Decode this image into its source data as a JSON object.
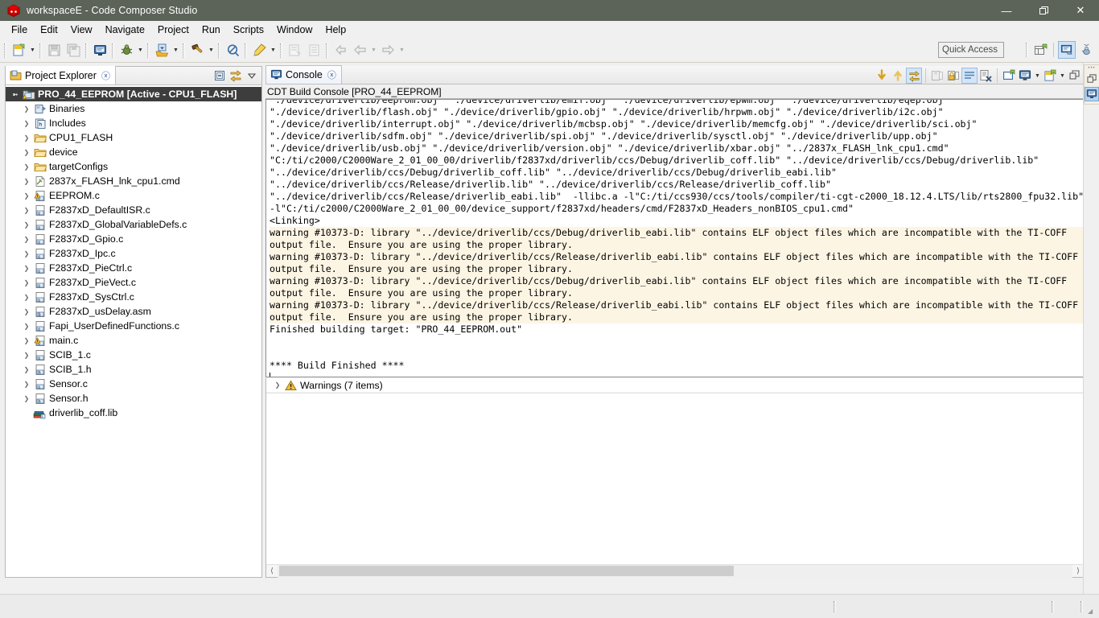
{
  "window": {
    "title": "workspaceE - Code Composer Studio",
    "app_icon": "ccs-cube-icon",
    "controls": [
      {
        "name": "minimize-button",
        "glyph": "—"
      },
      {
        "name": "restore-button",
        "glyph": "❐"
      },
      {
        "name": "close-button",
        "glyph": "✕"
      }
    ]
  },
  "menubar": {
    "items": [
      "File",
      "Edit",
      "View",
      "Navigate",
      "Project",
      "Run",
      "Scripts",
      "Window",
      "Help"
    ]
  },
  "toolbar": {
    "quick_access_placeholder": "Quick Access",
    "buttons": [
      {
        "name": "new-button",
        "icon": "new-file-icon"
      },
      {
        "name": "save-button",
        "icon": "save-icon"
      },
      {
        "name": "save-all-button",
        "icon": "save-all-icon"
      },
      {
        "name": "open-console-button",
        "icon": "console-monitor-icon"
      },
      {
        "name": "debug-button",
        "icon": "debug-bug-icon"
      },
      {
        "name": "resume-button",
        "icon": "import-icon"
      },
      {
        "name": "build-button",
        "icon": "hammer-icon"
      },
      {
        "name": "no-entry-button",
        "icon": "prohibited-icon"
      },
      {
        "name": "highlight-button",
        "icon": "marker-pen-icon"
      },
      {
        "name": "new-target-button",
        "icon": "target-config-icon"
      },
      {
        "name": "grid-button",
        "icon": "table-icon"
      },
      {
        "name": "back-nav-button",
        "icon": "back-arrow-icon"
      },
      {
        "name": "prev-button",
        "icon": "left-arrow-icon"
      },
      {
        "name": "next-button",
        "icon": "right-arrow-icon"
      }
    ],
    "perspective": [
      {
        "name": "open-perspective-button",
        "icon": "open-perspective-icon"
      },
      {
        "name": "perspective-ccs-edit",
        "icon": "ccs-edit-perspective-icon",
        "active": true
      },
      {
        "name": "perspective-ccs-debug",
        "icon": "ccs-debug-perspective-icon",
        "active": false
      }
    ]
  },
  "project_explorer": {
    "tab_label": "Project Explorer",
    "tab_icon": "project-explorer-icon",
    "close_icon": "close-icon",
    "toolbar": [
      {
        "name": "collapse-all-button",
        "icon": "collapse-all-icon"
      },
      {
        "name": "link-with-editor-button",
        "icon": "link-editor-icon"
      },
      {
        "name": "view-menu-button",
        "icon": "view-menu-chevron-icon"
      }
    ],
    "tree": [
      {
        "label": "PRO_44_EEPROM [Active - CPU1_FLASH]",
        "icon": "ccs-project-icon",
        "indent": 0,
        "twisty": "down",
        "selected": true
      },
      {
        "label": "Binaries",
        "icon": "binaries-icon",
        "indent": 1,
        "twisty": "right",
        "selected": false
      },
      {
        "label": "Includes",
        "icon": "includes-icon",
        "indent": 1,
        "twisty": "right",
        "selected": false
      },
      {
        "label": "CPU1_FLASH",
        "icon": "folder-icon",
        "indent": 1,
        "twisty": "right",
        "selected": false
      },
      {
        "label": "device",
        "icon": "folder-icon",
        "indent": 1,
        "twisty": "right",
        "selected": false
      },
      {
        "label": "targetConfigs",
        "icon": "folder-icon",
        "indent": 1,
        "twisty": "right",
        "selected": false
      },
      {
        "label": "2837x_FLASH_lnk_cpu1.cmd",
        "icon": "cmd-file-icon",
        "indent": 1,
        "twisty": "right",
        "selected": false
      },
      {
        "label": "EEPROM.c",
        "icon": "c-file-warning-icon",
        "indent": 1,
        "twisty": "right",
        "selected": false
      },
      {
        "label": "F2837xD_DefaultISR.c",
        "icon": "c-file-icon",
        "indent": 1,
        "twisty": "right",
        "selected": false
      },
      {
        "label": "F2837xD_GlobalVariableDefs.c",
        "icon": "c-file-icon",
        "indent": 1,
        "twisty": "right",
        "selected": false
      },
      {
        "label": "F2837xD_Gpio.c",
        "icon": "c-file-icon",
        "indent": 1,
        "twisty": "right",
        "selected": false
      },
      {
        "label": "F2837xD_Ipc.c",
        "icon": "c-file-icon",
        "indent": 1,
        "twisty": "right",
        "selected": false
      },
      {
        "label": "F2837xD_PieCtrl.c",
        "icon": "c-file-icon",
        "indent": 1,
        "twisty": "right",
        "selected": false
      },
      {
        "label": "F2837xD_PieVect.c",
        "icon": "c-file-icon",
        "indent": 1,
        "twisty": "right",
        "selected": false
      },
      {
        "label": "F2837xD_SysCtrl.c",
        "icon": "c-file-icon",
        "indent": 1,
        "twisty": "right",
        "selected": false
      },
      {
        "label": "F2837xD_usDelay.asm",
        "icon": "asm-file-icon",
        "indent": 1,
        "twisty": "right",
        "selected": false
      },
      {
        "label": "Fapi_UserDefinedFunctions.c",
        "icon": "c-file-icon",
        "indent": 1,
        "twisty": "right",
        "selected": false
      },
      {
        "label": "main.c",
        "icon": "c-file-warning-icon",
        "indent": 1,
        "twisty": "right",
        "selected": false
      },
      {
        "label": "SCIB_1.c",
        "icon": "c-file-icon",
        "indent": 1,
        "twisty": "right",
        "selected": false
      },
      {
        "label": "SCIB_1.h",
        "icon": "h-file-icon",
        "indent": 1,
        "twisty": "right",
        "selected": false
      },
      {
        "label": "Sensor.c",
        "icon": "c-file-icon",
        "indent": 1,
        "twisty": "right",
        "selected": false
      },
      {
        "label": "Sensor.h",
        "icon": "h-file-icon",
        "indent": 1,
        "twisty": "right",
        "selected": false
      },
      {
        "label": "driverlib_coff.lib",
        "icon": "library-icon",
        "indent": 1,
        "twisty": "none",
        "selected": false
      }
    ]
  },
  "console": {
    "tab_label": "Console",
    "tab_icon": "console-monitor-icon",
    "close_icon": "close-icon",
    "subtitle": "CDT Build Console [PRO_44_EEPROM]",
    "toolbar": [
      {
        "name": "scroll-lock-down-button",
        "icon": "down-arrow-icon"
      },
      {
        "name": "scroll-up-button",
        "icon": "up-arrow-icon"
      },
      {
        "name": "pin-console-button",
        "icon": "link-editor-icon",
        "active": true
      },
      {
        "name": "save-console-button",
        "icon": "save-console-icon"
      },
      {
        "name": "lock-console-button",
        "icon": "lock-icon"
      },
      {
        "name": "word-wrap-button",
        "icon": "word-wrap-icon",
        "active": true
      },
      {
        "name": "clear-console-button",
        "icon": "clear-console-icon"
      },
      {
        "name": "show-console-button",
        "icon": "show-console-icon"
      },
      {
        "name": "display-console-button",
        "icon": "console-monitor-icon"
      },
      {
        "name": "new-console-button",
        "icon": "new-console-icon"
      },
      {
        "name": "maximize-console-button",
        "icon": "restore-panel-icon"
      }
    ],
    "lines": [
      {
        "text": "\"./device/driverlib/eeprom.obj\" \"./device/driverlib/emif.obj\" \"./device/driverlib/epwm.obj\" \"./device/driverlib/eqep.obj\"",
        "warn": false,
        "clipped": true
      },
      {
        "text": "\"./device/driverlib/flash.obj\" \"./device/driverlib/gpio.obj\" \"./device/driverlib/hrpwm.obj\" \"./device/driverlib/i2c.obj\"",
        "warn": false
      },
      {
        "text": "\"./device/driverlib/interrupt.obj\" \"./device/driverlib/mcbsp.obj\" \"./device/driverlib/memcfg.obj\" \"./device/driverlib/sci.obj\"",
        "warn": false
      },
      {
        "text": "\"./device/driverlib/sdfm.obj\" \"./device/driverlib/spi.obj\" \"./device/driverlib/sysctl.obj\" \"./device/driverlib/upp.obj\"",
        "warn": false
      },
      {
        "text": "\"./device/driverlib/usb.obj\" \"./device/driverlib/version.obj\" \"./device/driverlib/xbar.obj\" \"../2837x_FLASH_lnk_cpu1.cmd\"",
        "warn": false
      },
      {
        "text": "\"C:/ti/c2000/C2000Ware_2_01_00_00/driverlib/f2837xd/driverlib/ccs/Debug/driverlib_coff.lib\" \"../device/driverlib/ccs/Debug/driverlib.lib\"",
        "warn": false
      },
      {
        "text": "\"../device/driverlib/ccs/Debug/driverlib_coff.lib\" \"../device/driverlib/ccs/Debug/driverlib_eabi.lib\"",
        "warn": false
      },
      {
        "text": "\"../device/driverlib/ccs/Release/driverlib.lib\" \"../device/driverlib/ccs/Release/driverlib_coff.lib\"",
        "warn": false
      },
      {
        "text": "\"../device/driverlib/ccs/Release/driverlib_eabi.lib\"  -llibc.a -l\"C:/ti/ccs930/ccs/tools/compiler/ti-cgt-c2000_18.12.4.LTS/lib/rts2800_fpu32.lib\"",
        "warn": false
      },
      {
        "text": "-l\"C:/ti/c2000/C2000Ware_2_01_00_00/device_support/f2837xd/headers/cmd/F2837xD_Headers_nonBIOS_cpu1.cmd\"",
        "warn": false
      },
      {
        "text": "<Linking>",
        "warn": false
      },
      {
        "text": "warning #10373-D: library \"../device/driverlib/ccs/Debug/driverlib_eabi.lib\" contains ELF object files which are incompatible with the TI-COFF",
        "warn": true
      },
      {
        "text": "output file.  Ensure you are using the proper library.",
        "warn": true
      },
      {
        "text": "warning #10373-D: library \"../device/driverlib/ccs/Release/driverlib_eabi.lib\" contains ELF object files which are incompatible with the TI-COFF",
        "warn": true
      },
      {
        "text": "output file.  Ensure you are using the proper library.",
        "warn": true
      },
      {
        "text": "warning #10373-D: library \"../device/driverlib/ccs/Debug/driverlib_eabi.lib\" contains ELF object files which are incompatible with the TI-COFF",
        "warn": true
      },
      {
        "text": "output file.  Ensure you are using the proper library.",
        "warn": true
      },
      {
        "text": "warning #10373-D: library \"../device/driverlib/ccs/Release/driverlib_eabi.lib\" contains ELF object files which are incompatible with the TI-COFF",
        "warn": true
      },
      {
        "text": "output file.  Ensure you are using the proper library.",
        "warn": true
      },
      {
        "text": "Finished building target: \"PRO_44_EEPROM.out\"",
        "warn": false
      },
      {
        "text": "",
        "warn": false
      },
      {
        "text": "",
        "warn": false
      },
      {
        "text": "**** Build Finished ****",
        "warn": false
      }
    ]
  },
  "problems": {
    "rows": [
      {
        "label": "Warnings (7 items)",
        "icon": "warning-icon",
        "twisty": "right"
      }
    ]
  },
  "fastview": {
    "buttons": [
      {
        "name": "restore-view-button",
        "icon": "restore-panel-icon",
        "active": false
      },
      {
        "name": "fastview-console-button",
        "icon": "console-monitor-icon",
        "active": true
      }
    ]
  },
  "colors": {
    "titlebar": "#5c6359",
    "accent_blue": "#3d6ea5",
    "warning_bg": "#fdf5e4",
    "selection": "#3d3d3d",
    "toolbar_bg": "#f0f0f0"
  }
}
